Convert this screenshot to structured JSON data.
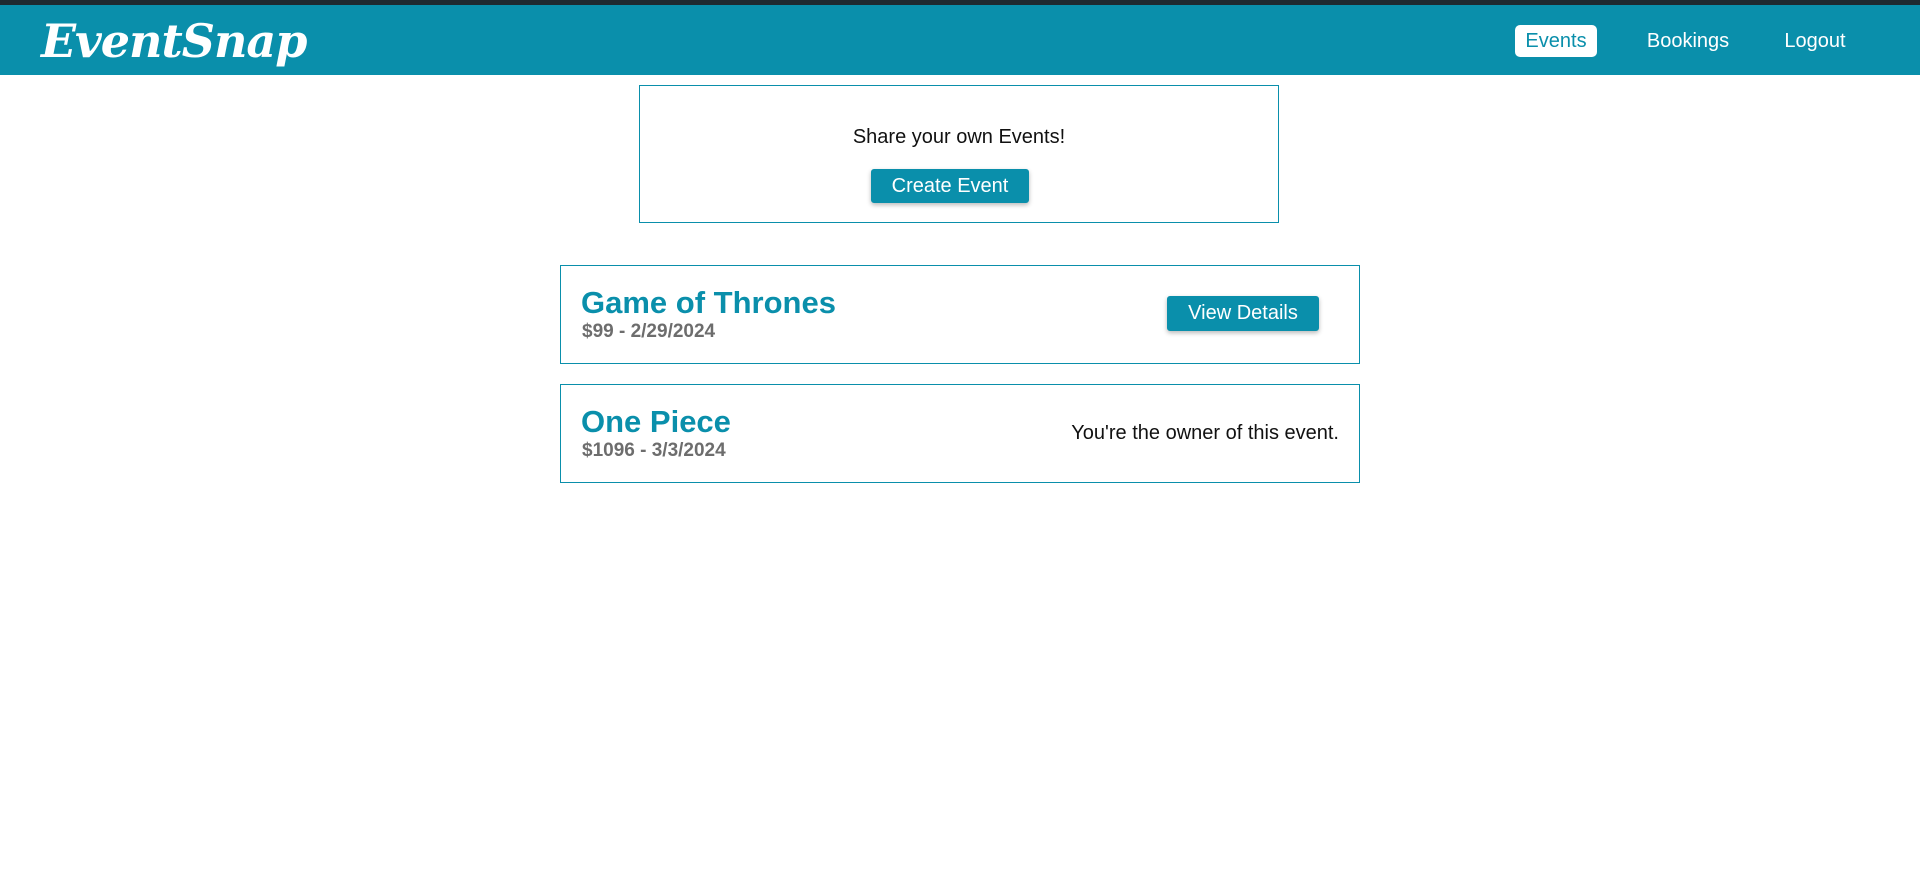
{
  "app": {
    "name": "EventSnap"
  },
  "nav": {
    "items": [
      {
        "label": "Events",
        "active": true
      },
      {
        "label": "Bookings",
        "active": false
      },
      {
        "label": "Logout",
        "active": false
      }
    ]
  },
  "create": {
    "prompt": "Share your own Events!",
    "button_label": "Create Event"
  },
  "events": [
    {
      "title": "Game of Thrones",
      "meta": "$99 - 2/29/2024",
      "action_label": "View Details"
    },
    {
      "title": "One Piece",
      "meta": "$1096 - 3/3/2024",
      "owner_note": "You're the owner of this event."
    }
  ],
  "colors": {
    "brand": "#0a8fab",
    "top_strip": "#1f2a30",
    "meta_text": "#6d6d6d",
    "background": "#ffffff"
  }
}
